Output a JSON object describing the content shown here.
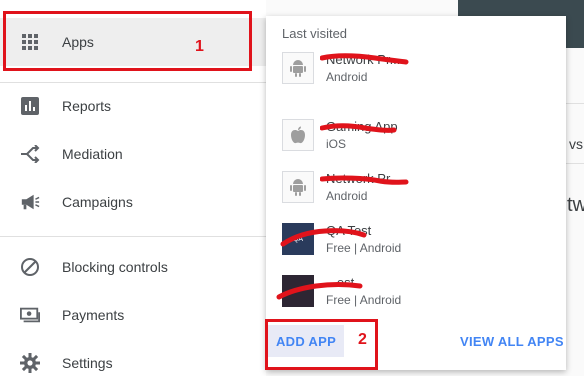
{
  "sidebar": {
    "apps_label": "Apps",
    "reports_label": "Reports",
    "mediation_label": "Mediation",
    "campaigns_label": "Campaigns",
    "blocking_label": "Blocking controls",
    "payments_label": "Payments",
    "settings_label": "Settings"
  },
  "annotations": {
    "marker_1": "1",
    "marker_2": "2",
    "highlight_color": "#e0131b"
  },
  "popup": {
    "header": "Last visited",
    "apps": [
      {
        "name": "Network Pr...",
        "subtitle": "Android",
        "icon": "android-icon"
      },
      {
        "name": "Gaming App",
        "subtitle": "iOS",
        "icon": "apple-icon"
      },
      {
        "name": "Network Pr...",
        "subtitle": "Android",
        "icon": "android-icon"
      },
      {
        "name": "QA Test",
        "subtitle": "Free | Android",
        "icon": "qa-app-icon",
        "icon_text": "QA"
      },
      {
        "name": "...est",
        "subtitle": "Free | Android",
        "icon": "dark-app-icon"
      }
    ],
    "add_app_label": "ADD APP",
    "view_all_label": "VIEW ALL APPS"
  },
  "background": {
    "partial_text_1": "vs",
    "partial_text_2": "tw"
  },
  "colors": {
    "accent": "#4285f4",
    "header_dark": "#3b4a50"
  }
}
